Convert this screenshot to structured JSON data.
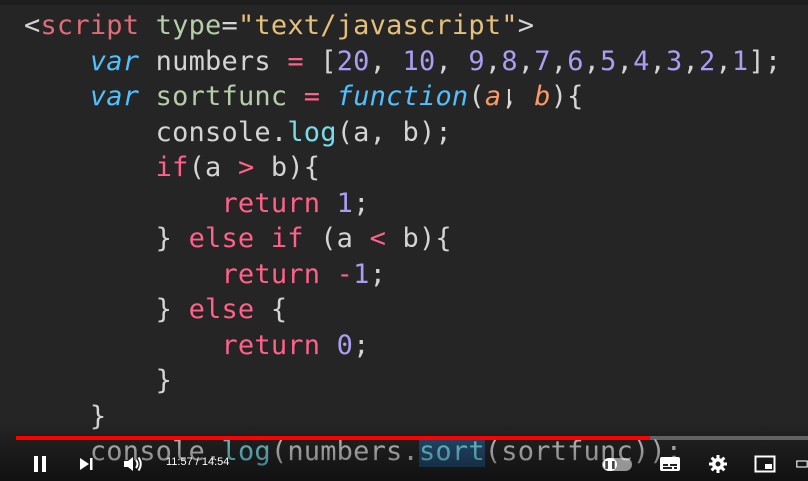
{
  "code": {
    "lines": [
      {
        "tokens": [
          {
            "t": "<",
            "c": "c-punc"
          },
          {
            "t": "script",
            "c": "c-tag"
          },
          {
            "t": " ",
            "c": "c-plain"
          },
          {
            "t": "type",
            "c": "c-attr"
          },
          {
            "t": "=",
            "c": "c-punc"
          },
          {
            "t": "\"text/javascript\"",
            "c": "c-str"
          },
          {
            "t": ">",
            "c": "c-punc"
          }
        ]
      },
      {
        "tokens": [
          {
            "t": "    ",
            "c": "c-plain"
          },
          {
            "t": "var",
            "c": "c-kw"
          },
          {
            "t": " numbers ",
            "c": "c-var"
          },
          {
            "t": "=",
            "c": "c-op"
          },
          {
            "t": " [",
            "c": "c-punc"
          },
          {
            "t": "20",
            "c": "c-num"
          },
          {
            "t": ", ",
            "c": "c-punc"
          },
          {
            "t": "10",
            "c": "c-num"
          },
          {
            "t": ", ",
            "c": "c-punc"
          },
          {
            "t": "9",
            "c": "c-num"
          },
          {
            "t": ",",
            "c": "c-punc"
          },
          {
            "t": "8",
            "c": "c-num"
          },
          {
            "t": ",",
            "c": "c-punc"
          },
          {
            "t": "7",
            "c": "c-num"
          },
          {
            "t": ",",
            "c": "c-punc"
          },
          {
            "t": "6",
            "c": "c-num"
          },
          {
            "t": ",",
            "c": "c-punc"
          },
          {
            "t": "5",
            "c": "c-num"
          },
          {
            "t": ",",
            "c": "c-punc"
          },
          {
            "t": "4",
            "c": "c-num"
          },
          {
            "t": ",",
            "c": "c-punc"
          },
          {
            "t": "3",
            "c": "c-num"
          },
          {
            "t": ",",
            "c": "c-punc"
          },
          {
            "t": "2",
            "c": "c-num"
          },
          {
            "t": ",",
            "c": "c-punc"
          },
          {
            "t": "1",
            "c": "c-num"
          },
          {
            "t": "];",
            "c": "c-punc"
          }
        ]
      },
      {
        "tokens": [
          {
            "t": "    ",
            "c": "c-plain"
          },
          {
            "t": "var",
            "c": "c-kw"
          },
          {
            "t": " ",
            "c": "c-plain"
          },
          {
            "t": "sortfunc",
            "c": "c-attr"
          },
          {
            "t": " ",
            "c": "c-plain"
          },
          {
            "t": "=",
            "c": "c-op"
          },
          {
            "t": " ",
            "c": "c-plain"
          },
          {
            "t": "function",
            "c": "c-kw"
          },
          {
            "t": "(",
            "c": "c-punc"
          },
          {
            "t": "a",
            "c": "c-param"
          },
          {
            "t": ", ",
            "c": "c-punc"
          },
          {
            "t": "b",
            "c": "c-param"
          },
          {
            "t": "){",
            "c": "c-punc"
          }
        ]
      },
      {
        "tokens": [
          {
            "t": "        console",
            "c": "c-plain"
          },
          {
            "t": ".",
            "c": "c-punc"
          },
          {
            "t": "log",
            "c": "c-fn"
          },
          {
            "t": "(a, b);",
            "c": "c-punc"
          }
        ]
      },
      {
        "tokens": [
          {
            "t": "        ",
            "c": "c-plain"
          },
          {
            "t": "if",
            "c": "c-ctrl"
          },
          {
            "t": "(a ",
            "c": "c-punc"
          },
          {
            "t": ">",
            "c": "c-op"
          },
          {
            "t": " b){",
            "c": "c-punc"
          }
        ]
      },
      {
        "tokens": [
          {
            "t": "            ",
            "c": "c-plain"
          },
          {
            "t": "return",
            "c": "c-ctrl"
          },
          {
            "t": " ",
            "c": "c-plain"
          },
          {
            "t": "1",
            "c": "c-num"
          },
          {
            "t": ";",
            "c": "c-punc"
          }
        ]
      },
      {
        "tokens": [
          {
            "t": "        } ",
            "c": "c-punc"
          },
          {
            "t": "else if",
            "c": "c-ctrl"
          },
          {
            "t": " (a ",
            "c": "c-punc"
          },
          {
            "t": "<",
            "c": "c-op"
          },
          {
            "t": " b){",
            "c": "c-punc"
          }
        ]
      },
      {
        "tokens": [
          {
            "t": "            ",
            "c": "c-plain"
          },
          {
            "t": "return",
            "c": "c-ctrl"
          },
          {
            "t": " ",
            "c": "c-plain"
          },
          {
            "t": "-",
            "c": "c-op"
          },
          {
            "t": "1",
            "c": "c-num"
          },
          {
            "t": ";",
            "c": "c-punc"
          }
        ]
      },
      {
        "tokens": [
          {
            "t": "        } ",
            "c": "c-punc"
          },
          {
            "t": "else",
            "c": "c-ctrl"
          },
          {
            "t": " {",
            "c": "c-punc"
          }
        ]
      },
      {
        "tokens": [
          {
            "t": "            ",
            "c": "c-plain"
          },
          {
            "t": "return",
            "c": "c-ctrl"
          },
          {
            "t": " ",
            "c": "c-plain"
          },
          {
            "t": "0",
            "c": "c-num"
          },
          {
            "t": ";",
            "c": "c-punc"
          }
        ]
      },
      {
        "tokens": [
          {
            "t": "        }",
            "c": "c-punc"
          }
        ]
      },
      {
        "tokens": [
          {
            "t": "    }",
            "c": "c-punc"
          }
        ]
      },
      {
        "tokens": [
          {
            "t": "    console",
            "c": "c-plain"
          },
          {
            "t": ".",
            "c": "c-punc"
          },
          {
            "t": "log",
            "c": "c-fn"
          },
          {
            "t": "(numbers.",
            "c": "c-punc"
          },
          {
            "t": "sort",
            "c": "c-fn c-hl"
          },
          {
            "t": "(sortfunc));",
            "c": "c-punc"
          }
        ]
      }
    ]
  },
  "player": {
    "time_display": "11:57 / 14:54",
    "progress_fraction": 0.8,
    "accent_color": "#ff0000",
    "controls": {
      "play_pause": "pause-icon",
      "next": "next-icon",
      "volume": "volume-icon",
      "autoplay": "autoplay-toggle",
      "subtitles": "subtitles-icon",
      "settings": "gear-icon",
      "miniplayer": "miniplayer-icon",
      "theater": "theater-icon"
    }
  }
}
